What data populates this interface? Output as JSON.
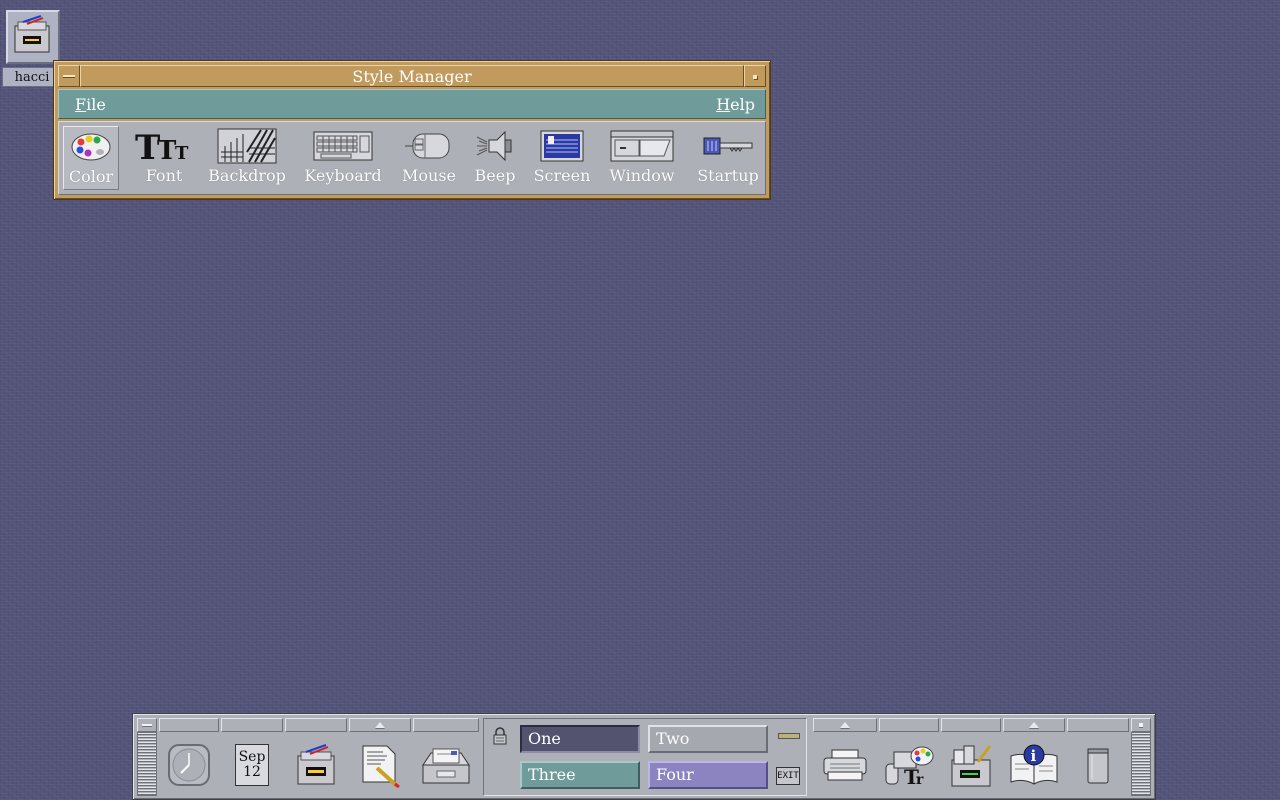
{
  "desktop": {
    "icon_label": "hacci"
  },
  "style_manager": {
    "title": "Style Manager",
    "menu": {
      "file": "File",
      "file_mnemonic": "F",
      "file_rest": "ile",
      "help": "Help",
      "help_mnemonic": "H",
      "help_rest": "elp"
    },
    "tools": [
      {
        "label": "Color",
        "icon": "palette-icon",
        "selected": true
      },
      {
        "label": "Font",
        "icon": "font-icon"
      },
      {
        "label": "Backdrop",
        "icon": "backdrop-icon"
      },
      {
        "label": "Keyboard",
        "icon": "keyboard-icon"
      },
      {
        "label": "Mouse",
        "icon": "mouse-icon"
      },
      {
        "label": "Beep",
        "icon": "speaker-icon"
      },
      {
        "label": "Screen",
        "icon": "screen-icon"
      },
      {
        "label": "Window",
        "icon": "window-icon"
      },
      {
        "label": "Startup",
        "icon": "key-icon"
      }
    ]
  },
  "front_panel": {
    "calendar": {
      "month": "Sep",
      "day": "12"
    },
    "workspaces": [
      {
        "label": "One",
        "active": true
      },
      {
        "label": "Two"
      },
      {
        "label": "Three"
      },
      {
        "label": "Four"
      }
    ],
    "exit_label": "EXIT",
    "left_icons": [
      "clock-icon",
      "calendar-icon",
      "file-manager-icon",
      "text-editor-icon",
      "mail-icon"
    ],
    "right_icons": [
      "printer-icon",
      "style-manager-icon",
      "application-manager-icon",
      "help-icon",
      "trash-icon"
    ]
  },
  "colors": {
    "desktop": "#525378",
    "window_frame": "#c19a5d",
    "menubar": "#6f9b9b",
    "panel": "#aeb0b8",
    "ws_one": "#535370",
    "ws_three": "#6f9b9b",
    "ws_four": "#8c84c0"
  }
}
